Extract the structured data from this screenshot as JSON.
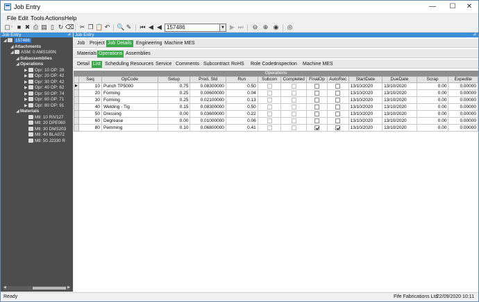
{
  "window": {
    "title": "Job Entry",
    "minimize": "—",
    "maximize": "☐",
    "close": "✕"
  },
  "menu": [
    "File",
    "Edit",
    "Tools",
    "Actions",
    "Help"
  ],
  "toolbar": {
    "job_key": "157486"
  },
  "left_panel": {
    "title": "Job Entry",
    "pin": "⊿",
    "tree": [
      {
        "label": "157486",
        "level": 0,
        "icon": "job-icon",
        "selected": true
      },
      {
        "label": "Attachments",
        "level": 1,
        "bold": true
      },
      {
        "label": "ASM: 0 AMS180N",
        "level": 1,
        "icon": "assembly-icon"
      },
      {
        "label": "Subassemblies",
        "level": 2,
        "bold": true
      },
      {
        "label": "Operations",
        "level": 2,
        "bold": true
      },
      {
        "label": "Opr: 10 OP: 28",
        "level": 3,
        "icon": "operation-icon"
      },
      {
        "label": "Opr: 20 OP: 42",
        "level": 3,
        "icon": "operation-icon"
      },
      {
        "label": "Opr: 30 OP: 42",
        "level": 3,
        "icon": "operation-icon"
      },
      {
        "label": "Opr: 40 OP: 62",
        "level": 3,
        "icon": "operation-icon"
      },
      {
        "label": "Opr: 50 OP: 74",
        "level": 3,
        "icon": "operation-icon"
      },
      {
        "label": "Opr: 60 OP: 71",
        "level": 3,
        "icon": "operation-icon"
      },
      {
        "label": "Opr: 80 OP: 91",
        "level": 3,
        "icon": "operation-icon"
      },
      {
        "label": "Materials",
        "level": 2,
        "bold": true
      },
      {
        "label": "Mtl: 10 RIV127",
        "level": 3,
        "icon": "material-icon"
      },
      {
        "label": "Mtl: 20 DPE060",
        "level": 3,
        "icon": "material-icon"
      },
      {
        "label": "Mtl: 30 DMS203",
        "level": 3,
        "icon": "material-icon"
      },
      {
        "label": "Mtl: 40 BLA072",
        "level": 3,
        "icon": "material-icon"
      },
      {
        "label": "Mtl: 50 J2330 R",
        "level": 3,
        "icon": "material-icon"
      }
    ]
  },
  "right_panel": {
    "title": "Job Entry",
    "pin": "⊿",
    "tabs_1": [
      {
        "label": "Job",
        "active": false
      },
      {
        "label": "Project",
        "active": false
      },
      {
        "label": "Job Details",
        "active": true
      },
      {
        "label": "Engineering",
        "active": false
      },
      {
        "label": "Machine MES",
        "active": false
      }
    ],
    "tabs_2": [
      {
        "label": "Materials",
        "active": false
      },
      {
        "label": "Operations",
        "active": true
      },
      {
        "label": "Assemblies",
        "active": false
      }
    ],
    "tabs_3": [
      {
        "label": "Detail",
        "active": false
      },
      {
        "label": "List",
        "active": true
      },
      {
        "label": "Scheduling Resources",
        "active": false
      },
      {
        "label": "Service",
        "active": false
      },
      {
        "label": "Comments",
        "active": false
      },
      {
        "label": "Subcontract",
        "active": false
      },
      {
        "label": "RoHS",
        "active": false
      },
      {
        "label": "Role Codes",
        "active": false
      },
      {
        "label": "Inspection",
        "active": false
      },
      {
        "label": "Machine MES",
        "active": false
      }
    ],
    "grid": {
      "caption": "Operations",
      "columns": [
        "Seq",
        "OpCode",
        "Setup",
        "Prod. Std",
        "Run",
        "Subcon",
        "Completed",
        "FinalOp",
        "AutoRec",
        "StartDate",
        "DueDate",
        "Scrap",
        "Expedite"
      ],
      "rows": [
        {
          "seq": "10",
          "opcode": "Punch TP5000",
          "setup": "0.75",
          "prod_std": "0.08300000",
          "run": "0.50",
          "subcon": false,
          "completed": false,
          "finalop": false,
          "autorec": false,
          "start": "13/10/2020",
          "due": "13/10/2020",
          "scrap": "0.00",
          "expedite": "0.00000",
          "current": true
        },
        {
          "seq": "20",
          "opcode": "Forming",
          "setup": "0.25",
          "prod_std": "0.00600000",
          "run": "0.04",
          "subcon": false,
          "completed": false,
          "finalop": false,
          "autorec": false,
          "start": "13/10/2020",
          "due": "13/10/2020",
          "scrap": "0.00",
          "expedite": "0.00000"
        },
        {
          "seq": "30",
          "opcode": "Forming",
          "setup": "0.25",
          "prod_std": "0.02100000",
          "run": "0.13",
          "subcon": false,
          "completed": false,
          "finalop": false,
          "autorec": false,
          "start": "13/10/2020",
          "due": "13/10/2020",
          "scrap": "0.00",
          "expedite": "0.00000"
        },
        {
          "seq": "40",
          "opcode": "Welding - Tig",
          "setup": "0.15",
          "prod_std": "0.08300000",
          "run": "0.50",
          "subcon": false,
          "completed": false,
          "finalop": false,
          "autorec": false,
          "start": "13/10/2020",
          "due": "13/10/2020",
          "scrap": "0.00",
          "expedite": "0.00000"
        },
        {
          "seq": "50",
          "opcode": "Dressing",
          "setup": "0.00",
          "prod_std": "0.03600000",
          "run": "0.22",
          "subcon": false,
          "completed": false,
          "finalop": false,
          "autorec": false,
          "start": "13/10/2020",
          "due": "13/10/2020",
          "scrap": "0.00",
          "expedite": "0.00000"
        },
        {
          "seq": "60",
          "opcode": "Degrease",
          "setup": "0.00",
          "prod_std": "0.01000000",
          "run": "0.06",
          "subcon": false,
          "completed": false,
          "finalop": false,
          "autorec": false,
          "start": "13/10/2020",
          "due": "13/10/2020",
          "scrap": "0.00",
          "expedite": "0.00000"
        },
        {
          "seq": "80",
          "opcode": "Pemming",
          "setup": "0.10",
          "prod_std": "0.06800000",
          "run": "0.41",
          "subcon": false,
          "completed": false,
          "finalop": true,
          "autorec": true,
          "start": "13/10/2020",
          "due": "13/10/2020",
          "scrap": "0.00",
          "expedite": "0.00000"
        }
      ]
    }
  },
  "status": {
    "text": "Ready",
    "company": "Fife Fabrications Ltd",
    "date": "22/09/2020",
    "time": "10:11"
  },
  "colors": {
    "accent_blue": "#3c8fd6",
    "active_tab_green": "#3aa84a",
    "tree_bg": "#4d4d4d"
  }
}
